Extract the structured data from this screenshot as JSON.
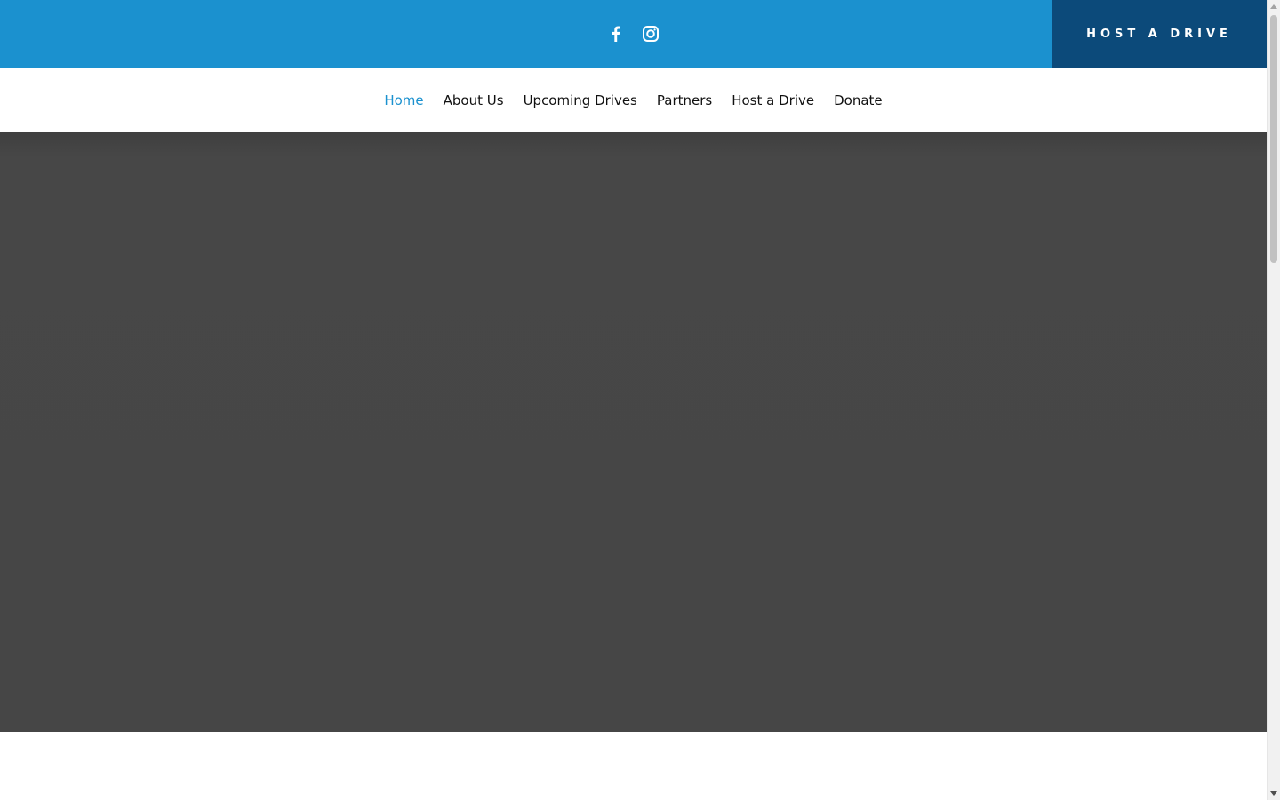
{
  "header": {
    "social_icons": [
      "facebook-icon",
      "instagram-icon"
    ],
    "cta_label": "HOST A DRIVE"
  },
  "nav": {
    "items": [
      {
        "label": "Home",
        "active": true
      },
      {
        "label": "About Us",
        "active": false
      },
      {
        "label": "Upcoming Drives",
        "active": false
      },
      {
        "label": "Partners",
        "active": false
      },
      {
        "label": "Host a Drive",
        "active": false
      },
      {
        "label": "Donate",
        "active": false
      }
    ]
  },
  "colors": {
    "topbar": "#1b91cf",
    "cta_background": "#0c4a7a",
    "active_nav": "#1b91cf",
    "hero_background": "#464646"
  }
}
